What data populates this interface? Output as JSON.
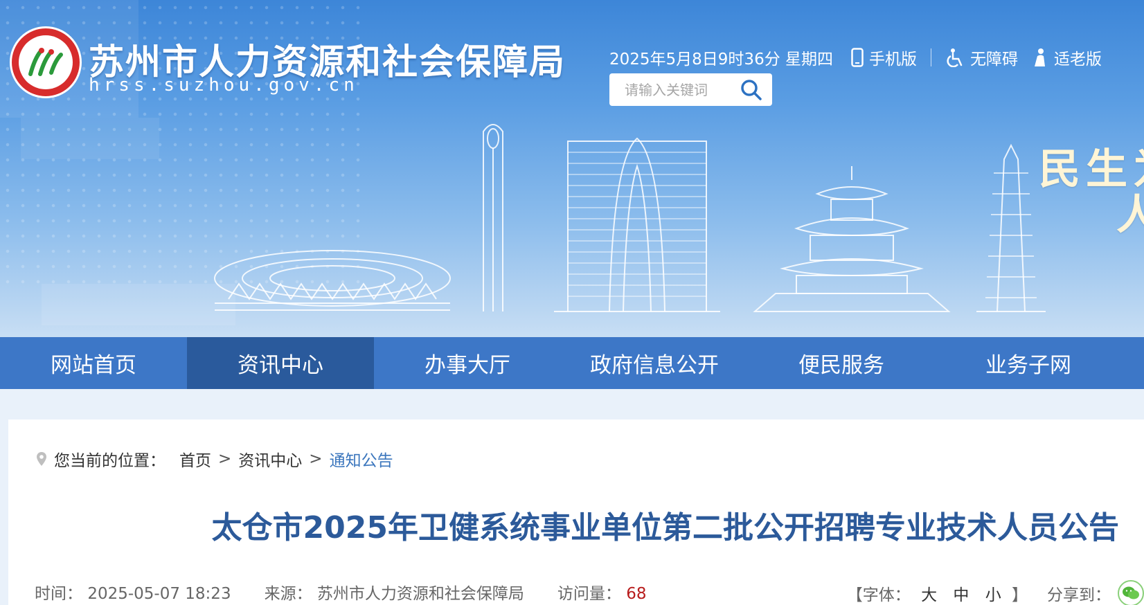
{
  "header": {
    "site_title": "苏州市人力资源和社会保障局",
    "site_domain": "hrss.suzhou.gov.cn",
    "datetime": "2025年5月8日9时36分 星期四",
    "links": [
      {
        "label": "手机版",
        "icon": "mobile-icon"
      },
      {
        "label": "无障碍",
        "icon": "accessibility-icon"
      },
      {
        "label": "适老版",
        "icon": "elder-icon"
      }
    ],
    "search_placeholder": "请输入关键词",
    "slogan_line1": "民生为",
    "slogan_line2": "人"
  },
  "nav": {
    "items": [
      {
        "label": "网站首页",
        "active": false
      },
      {
        "label": "资讯中心",
        "active": true
      },
      {
        "label": "办事大厅",
        "active": false
      },
      {
        "label": "政府信息公开",
        "active": false
      },
      {
        "label": "便民服务",
        "active": false
      },
      {
        "label": "业务子网",
        "active": false
      }
    ]
  },
  "breadcrumb": {
    "label": "您当前的位置：",
    "items": [
      "首页",
      "资讯中心",
      "通知公告"
    ],
    "separator": ">"
  },
  "article": {
    "title": "太仓市2025年卫健系统事业单位第二批公开招聘专业技术人员公告",
    "time_label": "时间：",
    "time": "2025-05-07 18:23",
    "source_label": "来源：",
    "source": "苏州市人力资源和社会保障局",
    "visits_label": "访问量：",
    "visits": "68",
    "font_open": "【字体：",
    "font_sizes": [
      "大",
      "中",
      "小"
    ],
    "font_close": "】",
    "share_label": "分享到："
  },
  "colors": {
    "nav_bg": "#3d77c7",
    "nav_active_bg": "#2a5a9c",
    "title_color": "#2c5a9a",
    "link_current": "#3b76bd",
    "visits_color": "#b81c1c",
    "logo_red": "#d72c2c"
  }
}
